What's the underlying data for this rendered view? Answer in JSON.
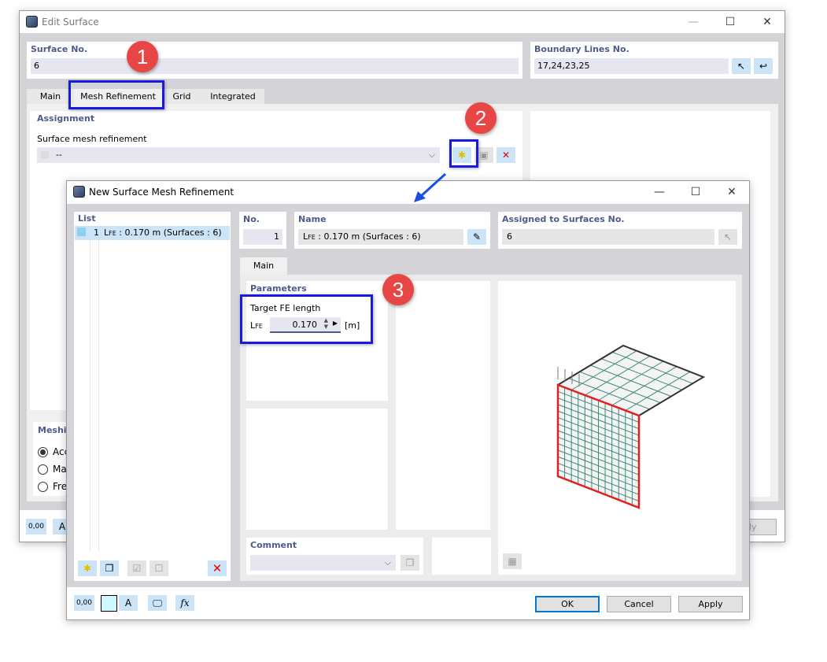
{
  "edit_surface": {
    "title": "Edit Surface",
    "surface_no_label": "Surface No.",
    "surface_no_value": "6",
    "boundary_label": "Boundary Lines No.",
    "boundary_value": "17,24,23,25",
    "tabs": [
      {
        "label": "Main"
      },
      {
        "label": "Mesh Refinement",
        "active": true
      },
      {
        "label": "Grid"
      },
      {
        "label": "Integrated"
      }
    ],
    "assignment_label": "Assignment",
    "smr_label": "Surface mesh refinement",
    "smr_value": "--",
    "meshing_label": "Meshin",
    "meshing_options": [
      {
        "label": "Acc",
        "selected": true
      },
      {
        "label": "Map",
        "selected": false
      },
      {
        "label": "Fre",
        "selected": false
      }
    ],
    "apply_label": "Apply"
  },
  "dialog": {
    "title": "New Surface Mesh Refinement",
    "list_label": "List",
    "list_items": [
      {
        "no": "1",
        "name_sym": "L",
        "name_sub": "FE",
        "name_rest": " : 0.170 m (Surfaces : 6)",
        "color": "#8fd0f0"
      }
    ],
    "no_label": "No.",
    "no_value": "1",
    "name_label": "Name",
    "name_sym": "L",
    "name_sub": "FE",
    "name_rest": " : 0.170 m (Surfaces : 6)",
    "assigned_label": "Assigned to Surfaces No.",
    "assigned_value": "6",
    "tab_main": "Main",
    "parameters_label": "Parameters",
    "target_label": "Target FE length",
    "lfe_sym": "L",
    "lfe_sub": "FE",
    "lfe_value": "0.170",
    "lfe_unit": "[m]",
    "comment_label": "Comment",
    "comment_value": "",
    "ok_label": "OK",
    "cancel_label": "Cancel",
    "apply_label": "Apply",
    "units_icon_text": "0,00"
  },
  "annotations": {
    "badges": [
      "1",
      "2",
      "3"
    ],
    "badge_color": "#e84545",
    "highlight_color": "#1a1adf"
  },
  "colors": {
    "mesh_line": "#3a8a78",
    "edge_red": "#e02020",
    "edge_dark": "#333333"
  }
}
